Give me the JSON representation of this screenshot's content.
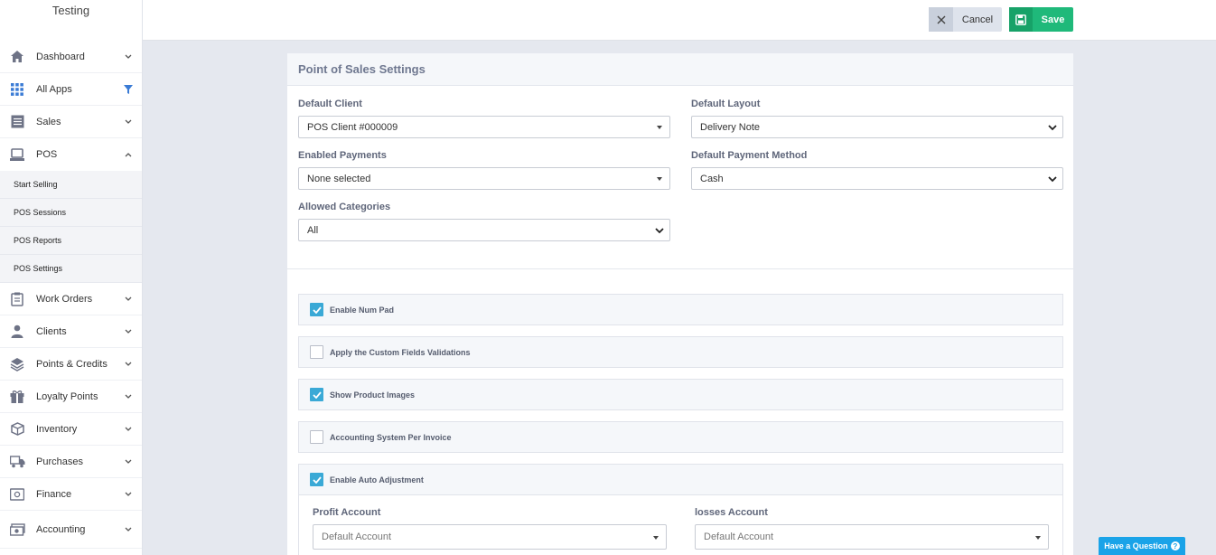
{
  "sidebar": {
    "brand": "Testing",
    "items": [
      {
        "label": "Dashboard",
        "icon": "home-icon"
      },
      {
        "label": "All Apps",
        "icon": "grid-icon"
      },
      {
        "label": "Sales",
        "icon": "list-icon"
      },
      {
        "label": "POS",
        "icon": "pos-icon"
      }
    ],
    "pos_sub": [
      "Start Selling",
      "POS Sessions",
      "POS Reports",
      "POS Settings"
    ],
    "items2": [
      {
        "label": "Work Orders",
        "icon": "clipboard-icon"
      },
      {
        "label": "Clients",
        "icon": "user-icon"
      },
      {
        "label": "Points & Credits",
        "icon": "layers-icon"
      },
      {
        "label": "Loyalty Points",
        "icon": "gift-icon"
      },
      {
        "label": "Inventory",
        "icon": "box-icon"
      },
      {
        "label": "Purchases",
        "icon": "truck-icon"
      },
      {
        "label": "Finance",
        "icon": "safe-icon"
      },
      {
        "label": "Accounting",
        "icon": "money-icon"
      }
    ]
  },
  "toolbar": {
    "cancel_label": "Cancel",
    "save_label": "Save"
  },
  "panel": {
    "title": "Point of Sales Settings",
    "default_client_label": "Default Client",
    "default_client_value": "POS Client #000009",
    "default_layout_label": "Default Layout",
    "default_layout_value": "Delivery Note",
    "enabled_payments_label": "Enabled Payments",
    "enabled_payments_value": "None selected",
    "default_payment_label": "Default Payment Method",
    "default_payment_value": "Cash",
    "allowed_categories_label": "Allowed Categories",
    "allowed_categories_value": "All",
    "options": [
      {
        "label": "Enable Num Pad",
        "checked": true
      },
      {
        "label": "Apply the Custom Fields Validations",
        "checked": false
      },
      {
        "label": "Show Product Images",
        "checked": true
      },
      {
        "label": "Accounting System Per Invoice",
        "checked": false
      },
      {
        "label": "Enable Auto Adjustment",
        "checked": true
      }
    ],
    "profit_account_label": "Profit Account",
    "profit_account_value": "Default Account",
    "losses_account_label": "losses Account",
    "losses_account_value": "Default Account"
  },
  "help_label": "Have a Question",
  "colors": {
    "accent": "#3aa9d6",
    "save": "#1fb97a",
    "help": "#1aa3e8"
  }
}
